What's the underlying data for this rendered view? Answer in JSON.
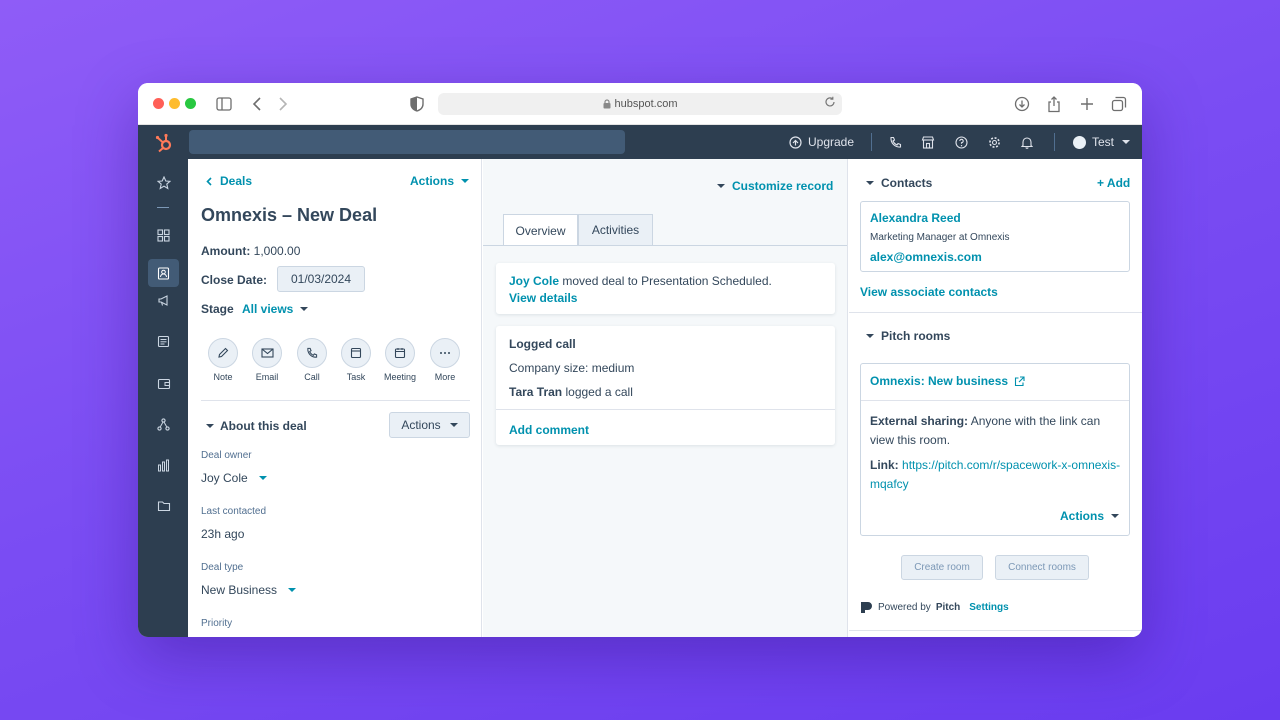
{
  "browser": {
    "url": "hubspot.com"
  },
  "topnav": {
    "upgrade_label": "Upgrade",
    "account_label": "Test"
  },
  "deal": {
    "back_label": "Deals",
    "actions_label": "Actions",
    "title": "Omnexis – New Deal",
    "amount_label": "Amount:",
    "amount_value": "1,000.00",
    "close_date_label": "Close Date:",
    "close_date_value": "01/03/2024",
    "stage_label": "Stage",
    "stage_value": "All views",
    "quick_actions": [
      {
        "label": "Note",
        "icon": "pencil-icon"
      },
      {
        "label": "Email",
        "icon": "email-icon"
      },
      {
        "label": "Call",
        "icon": "phone-icon"
      },
      {
        "label": "Task",
        "icon": "task-icon"
      },
      {
        "label": "Meeting",
        "icon": "calendar-icon"
      },
      {
        "label": "More",
        "icon": "more-icon"
      }
    ],
    "about_label": "About this deal",
    "about_actions_label": "Actions",
    "fields": [
      {
        "label": "Deal owner",
        "value": "Joy Cole",
        "dropdown": true
      },
      {
        "label": "Last contacted",
        "value": "23h ago",
        "dropdown": false
      },
      {
        "label": "Deal type",
        "value": "New Business",
        "dropdown": true
      },
      {
        "label": "Priority",
        "value": "",
        "dropdown": false
      }
    ]
  },
  "middle": {
    "customize_label": "Customize record",
    "tabs": [
      "Overview",
      "Activities"
    ],
    "activity1": {
      "name": "Joy Cole",
      "text": " moved deal to Presentation Scheduled.",
      "link": "View details"
    },
    "activity2": {
      "title": "Logged call",
      "line1": "Company size: medium",
      "name": "Tara Tran",
      "line2": " logged a call",
      "comment_label": "Add comment"
    }
  },
  "right": {
    "contacts_label": "Contacts",
    "add_label": "+ Add",
    "contact": {
      "name": "Alexandra Reed",
      "title": "Marketing Manager at Omnexis",
      "email": "alex@omnexis.com"
    },
    "view_assoc_label": "View associate contacts",
    "pitch_label": "Pitch rooms",
    "room": {
      "name": "Omnexis: New business",
      "sharing_label": "External sharing:",
      "sharing_text": " Anyone with the link can view this room.",
      "link_label": "Link:",
      "link_url": "https://pitch.com/r/spacework-x-omnexis-mqafcy",
      "actions_label": "Actions"
    },
    "create_room_label": "Create room",
    "connect_rooms_label": "Connect rooms",
    "powered_by_label": "Powered by",
    "powered_brand": "Pitch",
    "settings_label": "Settings"
  },
  "colors": {
    "nav": "#2d3e50",
    "link": "#0091ae",
    "accent": "#ff7a59",
    "background_gradient": "#7b4df3"
  }
}
